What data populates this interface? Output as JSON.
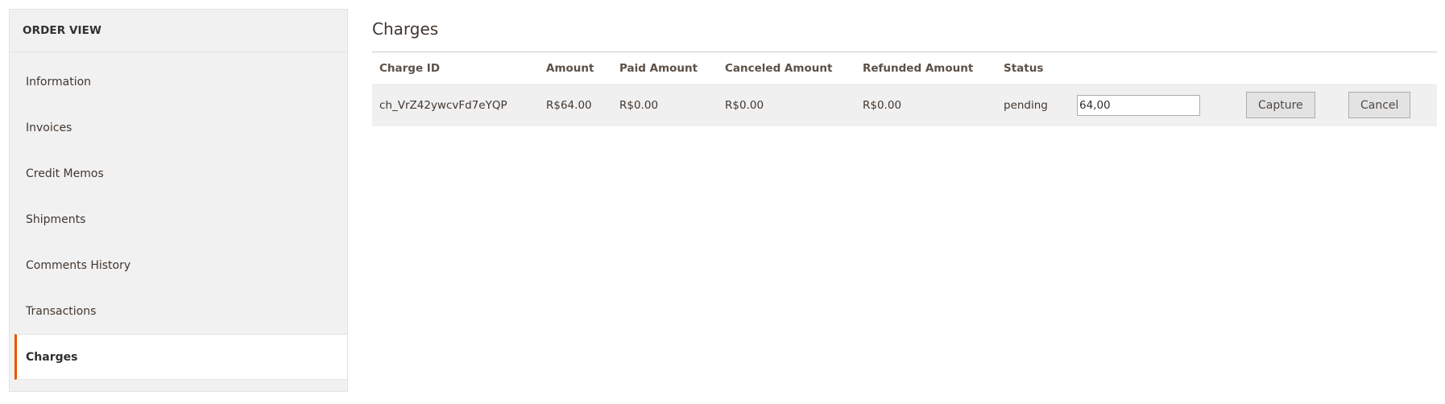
{
  "sidebar": {
    "title": "ORDER VIEW",
    "items": [
      {
        "label": "Information",
        "active": false
      },
      {
        "label": "Invoices",
        "active": false
      },
      {
        "label": "Credit Memos",
        "active": false
      },
      {
        "label": "Shipments",
        "active": false
      },
      {
        "label": "Comments History",
        "active": false
      },
      {
        "label": "Transactions",
        "active": false
      },
      {
        "label": "Charges",
        "active": true
      }
    ],
    "accent_color": "#eb5202"
  },
  "main": {
    "title": "Charges",
    "table": {
      "columns": [
        "Charge ID",
        "Amount",
        "Paid Amount",
        "Canceled Amount",
        "Refunded Amount",
        "Status",
        "",
        "",
        ""
      ],
      "rows": [
        {
          "charge_id": "ch_VrZ42ywcvFd7eYQP",
          "amount": "R$64.00",
          "paid_amount": "R$0.00",
          "canceled_amount": "R$0.00",
          "refunded_amount": "R$0.00",
          "status": "pending",
          "input_value": "64,00",
          "capture_label": "Capture",
          "cancel_label": "Cancel"
        }
      ]
    }
  }
}
